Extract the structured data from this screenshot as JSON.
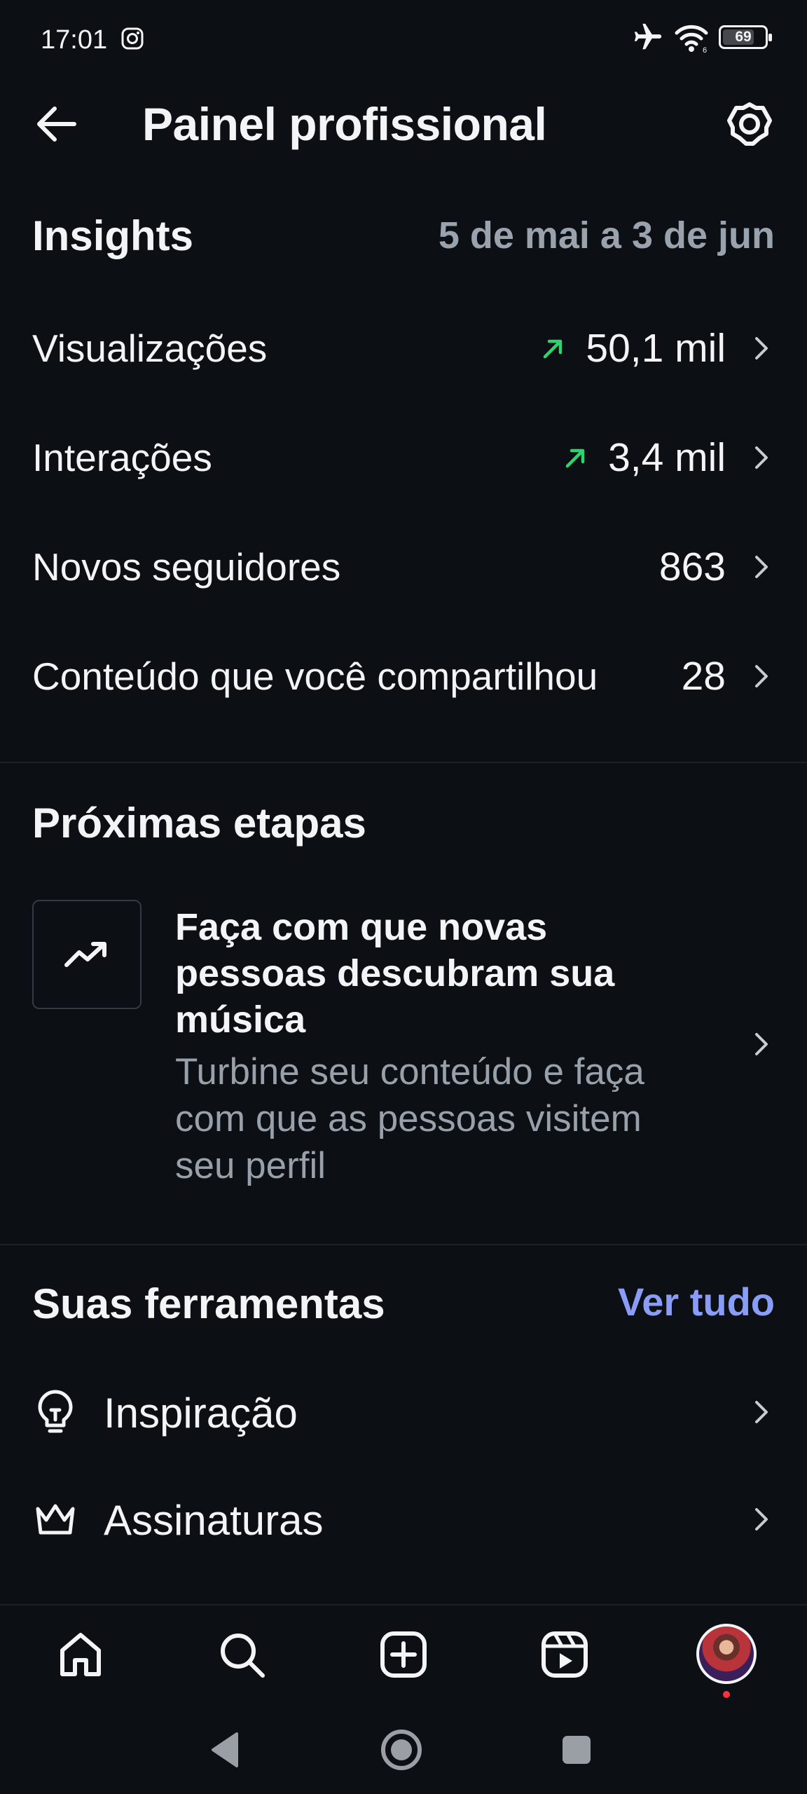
{
  "status_bar": {
    "time": "17:01",
    "battery": "69",
    "icons": [
      "instagram-icon",
      "airplane-mode-icon",
      "wifi-icon",
      "battery-icon"
    ]
  },
  "header": {
    "title": "Painel profissional",
    "back_icon": "arrow-left-icon",
    "settings_icon": "gear-icon"
  },
  "insights": {
    "title": "Insights",
    "date_range": "5 de mai a 3 de jun",
    "rows": [
      {
        "label": "Visualizações",
        "value": "50,1 mil",
        "trend": "up"
      },
      {
        "label": "Interações",
        "value": "3,4 mil",
        "trend": "up"
      },
      {
        "label": "Novos seguidores",
        "value": "863",
        "trend": ""
      },
      {
        "label": "Conteúdo que você compartilhou",
        "value": "28",
        "trend": ""
      }
    ]
  },
  "next_steps": {
    "title": "Próximas etapas",
    "card": {
      "icon": "trending-up-icon",
      "title": "Faça com que novas pessoas descubram sua música",
      "description": "Turbine seu conteúdo e faça com que as pessoas visitem seu perfil"
    }
  },
  "tools": {
    "title": "Suas ferramentas",
    "see_all": "Ver tudo",
    "items": [
      {
        "label": "Inspiração",
        "icon": "lightbulb-icon"
      },
      {
        "label": "Assinaturas",
        "icon": "crown-icon"
      }
    ]
  },
  "bottom_nav": {
    "items": [
      "home-icon",
      "search-icon",
      "create-icon",
      "reels-icon",
      "profile-avatar"
    ]
  },
  "colors": {
    "background": "#0c0f14",
    "text": "#f2f4f6",
    "muted": "#98a0aa",
    "link": "#8a9df6",
    "trend_up": "#2fd36d",
    "notification_dot": "#ff3040"
  }
}
